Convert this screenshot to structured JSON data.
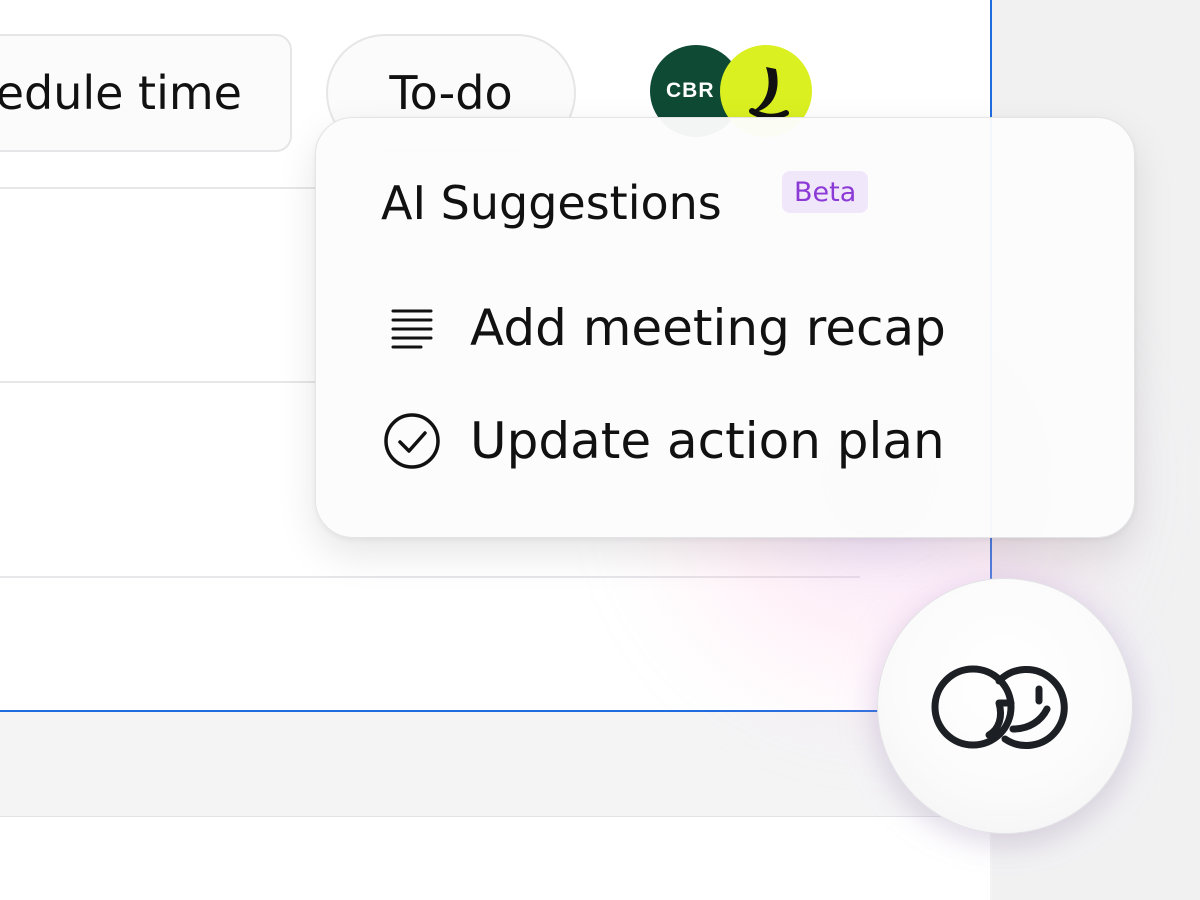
{
  "toolbar": {
    "schedule_label": "edule time",
    "todo_label": "To-do"
  },
  "avatars": [
    {
      "initials": "CBR",
      "color": "#0f4a35"
    },
    {
      "initials": "",
      "color": "#daf020"
    }
  ],
  "ai_popup": {
    "title": "AI Suggestions",
    "badge": "Beta",
    "items": [
      {
        "label": "Add meeting recap",
        "icon": "lines-icon"
      },
      {
        "label": "Update action plan",
        "icon": "check-circle-icon"
      }
    ]
  },
  "assistant_button": {
    "icon": "assistant-logo-icon"
  },
  "colors": {
    "accent_border": "#1f6be0",
    "beta_text": "#8b3ad6",
    "beta_bg": "#f1e7fb"
  }
}
